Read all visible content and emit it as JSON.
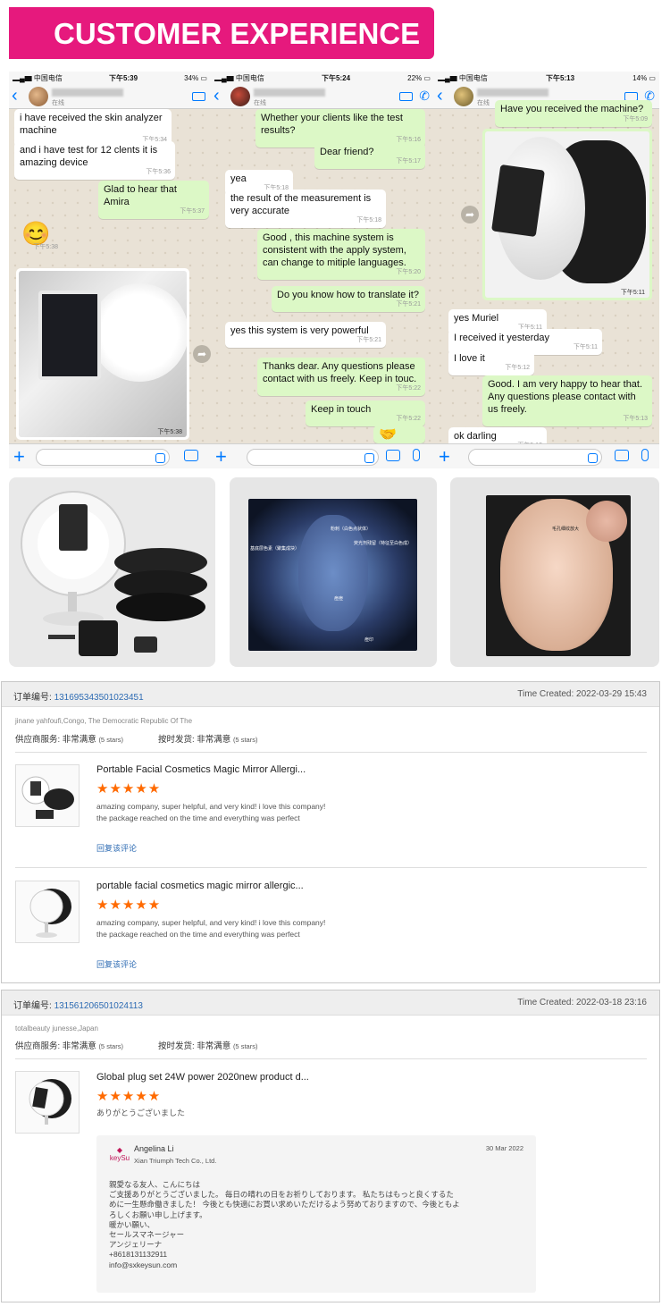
{
  "banner": {
    "title": "CUSTOMER EXPERIENCE"
  },
  "phones": [
    {
      "status": {
        "carrier": "中国电信",
        "time": "下午5:39",
        "battery": "34%"
      },
      "online": "在线",
      "messages": [
        {
          "dir": "in",
          "text": "i have received the skin analyzer machine",
          "time": "下午5:34"
        },
        {
          "dir": "in",
          "text": "and i have test for 12 clents  it is amazing device",
          "time": "下午5:36"
        },
        {
          "dir": "out",
          "text": "Glad to hear that Amira",
          "time": "下午5:37"
        },
        {
          "dir": "in",
          "text": "😊",
          "time": "下午5:38"
        },
        {
          "dir": "in",
          "text": "",
          "time": "下午5:38"
        }
      ]
    },
    {
      "status": {
        "carrier": "中国电信",
        "time": "下午5:24",
        "battery": "22%"
      },
      "online": "在线",
      "messages": [
        {
          "dir": "out",
          "text": "Whether your clients like the test results?",
          "time": "下午5:16"
        },
        {
          "dir": "out",
          "text": "Dear friend?",
          "time": "下午5:17"
        },
        {
          "dir": "in",
          "text": "yea",
          "time": "下午5:18"
        },
        {
          "dir": "in",
          "text": "the result of the measurement is very accurate",
          "time": "下午5:18"
        },
        {
          "dir": "out",
          "text": "Good , this machine system is consistent with the apply system, can change to mitiple languages.",
          "time": "下午5:20"
        },
        {
          "dir": "out",
          "text": "Do you know how to translate it?",
          "time": "下午5:21"
        },
        {
          "dir": "in",
          "text": "yes  this system is very powerful",
          "time": "下午5:21"
        },
        {
          "dir": "out",
          "text": "Thanks dear. Any questions please contact with us freely. Keep in touc.",
          "time": "下午5:22"
        },
        {
          "dir": "out",
          "text": "Keep in touch",
          "time": "下午5:22"
        }
      ]
    },
    {
      "status": {
        "carrier": "中国电信",
        "time": "下午5:13",
        "battery": "14%"
      },
      "online": "在线",
      "messages": [
        {
          "dir": "out",
          "text": "Have you received the machine?",
          "time": "下午5:09"
        },
        {
          "dir": "out",
          "text": "",
          "time": "下午5:11"
        },
        {
          "dir": "in",
          "text": "yes Muriel",
          "time": "下午5:11"
        },
        {
          "dir": "in",
          "text": "I received it yesterday",
          "time": "下午5:11"
        },
        {
          "dir": "in",
          "text": "I love it",
          "time": "下午5:12"
        },
        {
          "dir": "out",
          "text": "Good. I am very happy to hear that. Any questions please contact with us freely.",
          "time": "下午5:13"
        },
        {
          "dir": "in",
          "text": "ok darling",
          "time": "下午5:13"
        }
      ]
    }
  ],
  "photos": {
    "uv_labels": [
      "粉刺（白色点状体）",
      "基底层色素（聚集成块）",
      "荧光剂残留（特征至白色成）",
      "痘痘",
      "痘印"
    ],
    "skin_label": "毛孔细纹放大"
  },
  "orders": [
    {
      "order_label": "订单编号:",
      "order_no": "131695343501023451",
      "time_created": "Time Created: 2022-03-29 15:43",
      "buyer": "jinane yahfoufi,Congo, The Democratic Republic Of The",
      "service_label": "供应商服务:",
      "service_value": "非常满意",
      "service_stars": "(5 stars)",
      "ontime_label": "按时发货:",
      "ontime_value": "非常满意",
      "ontime_stars": "(5 stars)",
      "items": [
        {
          "title": "Portable Facial Cosmetics Magic Mirror Allergi...",
          "stars": "★★★★★",
          "review_line1": "amazing company,  super helpful, and very kind! i love this company!",
          "review_line2": "the package reached on the time and everything was perfect",
          "reply": "回复该评论"
        },
        {
          "title": "portable facial cosmetics magic mirror allergic...",
          "stars": "★★★★★",
          "review_line1": "amazing company, super helpful, and very kind! i love this company!",
          "review_line2": "the package reached on the time and everything was perfect",
          "reply": "回复该评论"
        }
      ]
    },
    {
      "order_label": "订单编号:",
      "order_no": "131561206501024113",
      "time_created": "Time Created: 2022-03-18 23:16",
      "buyer": "totalbeauty junesse,Japan",
      "service_label": "供应商服务:",
      "service_value": "非常满意",
      "service_stars": "(5 stars)",
      "ontime_label": "按时发货:",
      "ontime_value": "非常满意",
      "ontime_stars": "(5 stars)",
      "items": [
        {
          "title": "Global plug set 24W power 2020new product d...",
          "stars": "★★★★★",
          "review_line1": "ありがとうございました"
        }
      ],
      "seller_reply": {
        "logo": "keySu",
        "name": "Angelina Li",
        "company": "Xian Triumph Tech Co., Ltd.",
        "date": "30 Mar 2022",
        "lines": [
          "親愛なる友人、こんにちは",
          "ご支援ありがとうございました。 毎日の晴れの日をお祈りしております。 私たちはもっと良くするた",
          "めに一生懸命働きました！ 今後とも快適にお買い求めいただけるよう努めておりますので、今後ともよ",
          "ろしくお願い申し上げます。",
          "暖かい願い、",
          "セールスマネージャー",
          "アンジェリーナ",
          "+8618131132911",
          "info@sxkeysun.com"
        ]
      }
    }
  ]
}
